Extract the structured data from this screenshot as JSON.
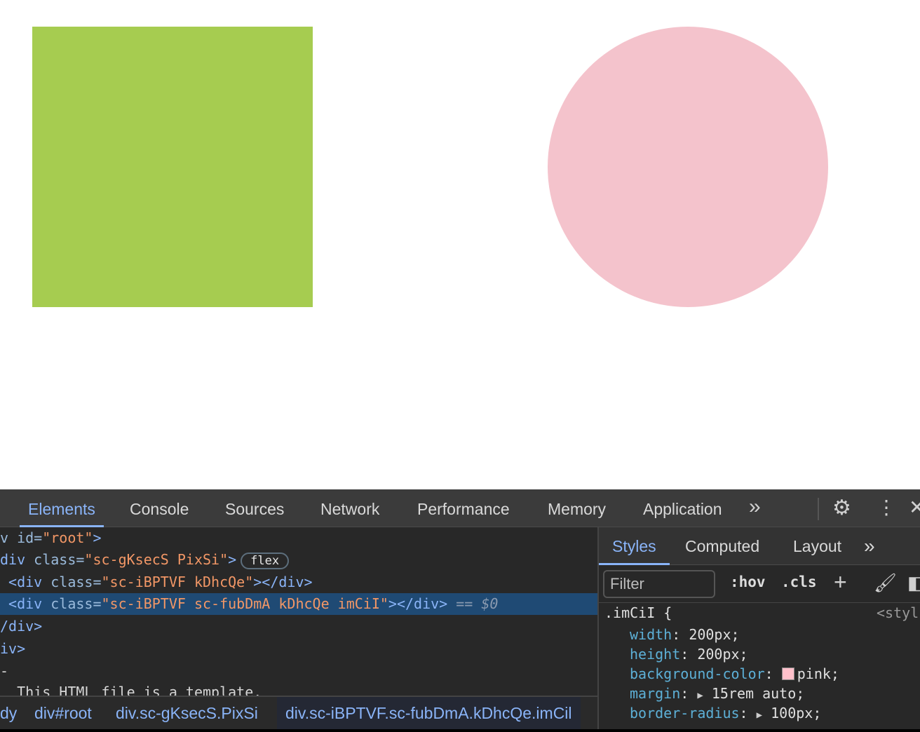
{
  "page": {
    "square_color": "#a6cc50",
    "circle_color": "#f4c3cc"
  },
  "toolbar": {
    "tabs": [
      "Elements",
      "Console",
      "Sources",
      "Network",
      "Performance",
      "Memory",
      "Application"
    ],
    "more": "»"
  },
  "elements": {
    "l0": {
      "a": "v id=",
      "v": "\"root\"",
      "e": ">"
    },
    "l1": {
      "t": "div ",
      "a": "class=",
      "v": "\"sc-gKsecS PixSi\"",
      "e": ">",
      "badge": "flex"
    },
    "l2": {
      "t": " <div ",
      "a": "class=",
      "v": "\"sc-iBPTVF kDhcQe\"",
      "e": "></div>"
    },
    "l3": {
      "t": " <div ",
      "a": "class=",
      "v": "\"sc-iBPTVF sc-fubDmA kDhcQe imCiI\"",
      "e": "></div>",
      "eq": " == ",
      "ref": "$0"
    },
    "l4": "/div>",
    "l5": "iv>",
    "l6": "-",
    "l7": "  This HTML file is a template."
  },
  "breadcrumbs": [
    "dy",
    "div#root",
    "div.sc-gKsecS.PixSi",
    "div.sc-iBPTVF.sc-fubDmA.kDhcQe.imCil"
  ],
  "styles": {
    "tabs": [
      "Styles",
      "Computed",
      "Layout"
    ],
    "filter_placeholder": "Filter",
    "hov": ":hov",
    "cls": ".cls",
    "selector": ".imCiI {",
    "source": "<styl",
    "props": [
      {
        "name": "width",
        "value": "200px;"
      },
      {
        "name": "height",
        "value": "200px;"
      },
      {
        "name": "background-color",
        "value": "pink;",
        "swatch": "#ffc0cb"
      },
      {
        "name": "margin",
        "value": "15rem auto;"
      },
      {
        "name": "border-radius",
        "value": "100px;"
      }
    ]
  }
}
